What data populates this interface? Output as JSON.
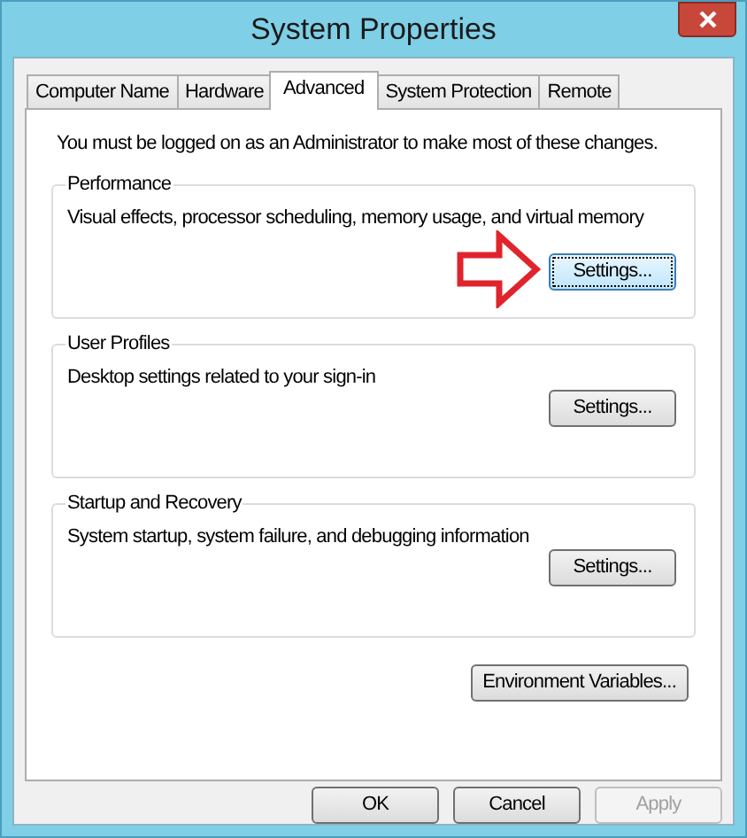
{
  "window": {
    "title": "System Properties"
  },
  "tabs": [
    {
      "label": "Computer Name",
      "selected": false
    },
    {
      "label": "Hardware",
      "selected": false
    },
    {
      "label": "Advanced",
      "selected": true
    },
    {
      "label": "System Protection",
      "selected": false
    },
    {
      "label": "Remote",
      "selected": false
    }
  ],
  "notice": "You must be logged on as an Administrator to make most of these changes.",
  "groups": [
    {
      "title": "Performance",
      "description": "Visual effects, processor scheduling, memory usage, and virtual memory",
      "button": {
        "label": "Settings...",
        "focused": true
      },
      "annotated": true
    },
    {
      "title": "User Profiles",
      "description": "Desktop settings related to your sign-in",
      "button": {
        "label": "Settings...",
        "focused": false
      },
      "annotated": false
    },
    {
      "title": "Startup and Recovery",
      "description": "System startup, system failure, and debugging information",
      "button": {
        "label": "Settings...",
        "focused": false
      },
      "annotated": false
    }
  ],
  "environment_button": {
    "label": "Environment Variables..."
  },
  "dialog_buttons": [
    {
      "label": "OK",
      "disabled": false
    },
    {
      "label": "Cancel",
      "disabled": false
    },
    {
      "label": "Apply",
      "disabled": true
    }
  ]
}
